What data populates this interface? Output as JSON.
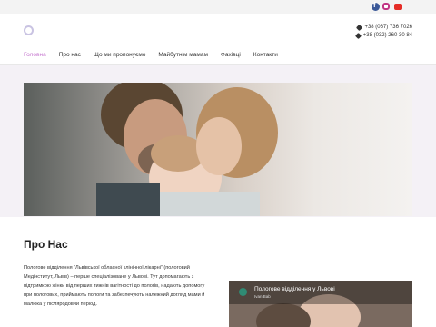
{
  "phones": [
    "+38 (067) 736 7026",
    "+38 (032) 260 30 84"
  ],
  "nav": {
    "items": [
      {
        "label": "Головна",
        "active": true
      },
      {
        "label": "Про нас"
      },
      {
        "label": "Що ми пропонуємо"
      },
      {
        "label": "Майбутнім мамам"
      },
      {
        "label": "Фахівці"
      },
      {
        "label": "Контакти"
      }
    ]
  },
  "social": [
    "facebook-icon",
    "instagram-icon",
    "youtube-icon"
  ],
  "colors": {
    "accent": "#c77ad0",
    "topbar": "#f3f3f3"
  },
  "about": {
    "title": "Про Нас",
    "text": "Пологове відділення “Львівської обласної клінічної лікарні” (пологовий Медінститут, Львів) – перше спеціалізоване у Львові. Тут допомагають з підтримкою жінки від перших тижнів вагітності до пологів, надають допомогу при пологових, приймають пологи та забезпечують належний догляд мами й малюка у післяродовий період."
  },
  "video": {
    "icon_letter": "i",
    "title": "Пологове відділення у Львові",
    "channel": "Ivan Bab"
  }
}
